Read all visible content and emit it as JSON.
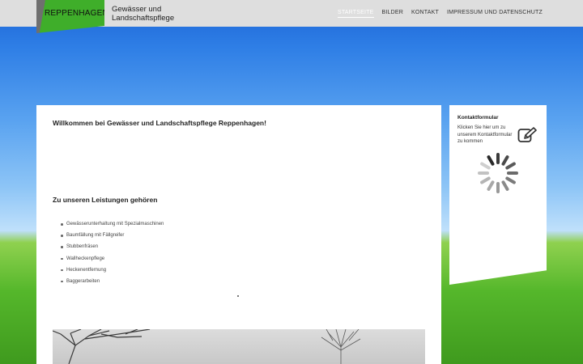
{
  "header": {
    "logo_text": "REPPENHAGEN",
    "site_title": "Gewässer und Landschaftspflege",
    "nav": [
      {
        "label": "STARTSEITE",
        "active": true
      },
      {
        "label": "BILDER",
        "active": false
      },
      {
        "label": "KONTAKT",
        "active": false
      },
      {
        "label": "IMPRESSUM UND DATENSCHUTZ",
        "active": false
      }
    ]
  },
  "main": {
    "welcome": "Willkommen bei Gewässer und Landschaftspflege Reppenhagen!",
    "services_heading": "Zu unseren Leistungen gehören",
    "services": [
      "Gewässerunterhaltung mit Spezialmaschinen",
      "Baumfällung mit Fällgreifer",
      "Stubbenfräsen",
      "Wallheckenpflege",
      "Heckenentfernung",
      "Baggerarbeiten"
    ]
  },
  "sidebar": {
    "title": "Kontaktformular",
    "text": "Klicken Sie hier um zu unserem Kontaktformular zu kommen",
    "icon": "edit-icon"
  },
  "colors": {
    "brand_green": "#3fae2a",
    "header_bg": "#dedede"
  }
}
